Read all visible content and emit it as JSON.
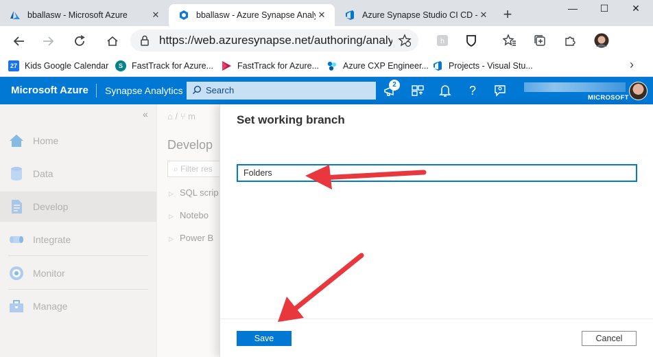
{
  "browser": {
    "tabs": [
      {
        "label": "bballasw - Microsoft Azure",
        "icon": "azure-logo-icon",
        "active": false
      },
      {
        "label": "bballasw - Azure Synapse Analyti",
        "icon": "synapse-icon",
        "active": true
      },
      {
        "label": "Azure Synapse Studio CI CD - Re",
        "icon": "azure-devops-icon",
        "active": false
      }
    ],
    "new_tab_label": "+",
    "window_controls": [
      "—",
      "☐",
      "✕"
    ],
    "url": "https://web.azuresynapse.net/authoring/analy...",
    "bookmarks": [
      {
        "label": "Kids Google Calendar",
        "icon": "calendar-icon",
        "icon_text": "27",
        "color": "#1a73e8"
      },
      {
        "label": "FastTrack for Azure...",
        "icon": "sharepoint-icon",
        "icon_text": "S",
        "color": "#038387"
      },
      {
        "label": "FastTrack for Azure...",
        "icon": "stream-icon",
        "icon_text": "",
        "color": "#bc1948"
      },
      {
        "label": "Azure CXP Engineer...",
        "icon": "cxp-icon",
        "icon_text": "",
        "color": "#0078d4"
      },
      {
        "label": "Projects - Visual Stu...",
        "icon": "visual-studio-icon",
        "icon_text": "",
        "color": "#0078d4"
      }
    ]
  },
  "azure_header": {
    "brand": "Microsoft Azure",
    "product": "Synapse Analytics",
    "search_placeholder": "Search",
    "notification_count": "2",
    "tenant": "MICROSOFT",
    "accent": "#0078d4"
  },
  "leftnav": {
    "collapse_label": "«",
    "items": [
      {
        "label": "Home",
        "icon": "home-icon"
      },
      {
        "label": "Data",
        "icon": "database-icon"
      },
      {
        "label": "Develop",
        "icon": "develop-icon",
        "active": true
      },
      {
        "label": "Integrate",
        "icon": "pipeline-icon"
      },
      {
        "label": "Monitor",
        "icon": "monitor-icon"
      },
      {
        "label": "Manage",
        "icon": "toolbox-icon"
      }
    ]
  },
  "develop_panel": {
    "breadcrumb": "⌂  /  ⑂  m",
    "title": "Develop",
    "filter_placeholder": "Filter res",
    "tree": [
      "SQL scrip",
      "Notebo",
      "Power B"
    ]
  },
  "dialog": {
    "title": "Set working branch",
    "branch_value": "Folders",
    "save_label": "Save",
    "cancel_label": "Cancel"
  },
  "annotation": {
    "arrow_color": "#e8383d"
  }
}
